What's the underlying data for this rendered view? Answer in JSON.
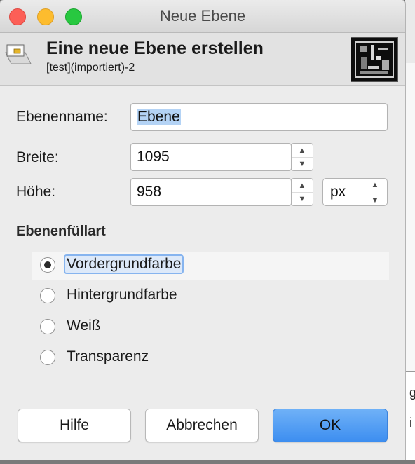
{
  "window": {
    "title": "Neue Ebene"
  },
  "header": {
    "title": "Eine neue Ebene erstellen",
    "subtitle": "[test](importiert)-2"
  },
  "form": {
    "name_label": "Ebenenname:",
    "name_value": "Ebene",
    "width_label": "Breite:",
    "width_value": "1095",
    "height_label": "Höhe:",
    "height_value": "958",
    "unit_value": "px"
  },
  "fill": {
    "title": "Ebenenfüllart",
    "options": [
      {
        "label": "Vordergrundfarbe",
        "selected": true
      },
      {
        "label": "Hintergrundfarbe",
        "selected": false
      },
      {
        "label": "Weiß",
        "selected": false
      },
      {
        "label": "Transparenz",
        "selected": false
      }
    ]
  },
  "buttons": {
    "help": "Hilfe",
    "cancel": "Abbrechen",
    "ok": "OK"
  },
  "background": {
    "fragment_1": "g",
    "fragment_2": "i"
  },
  "colors": {
    "accent": "#3d8ef0",
    "selection": "#b4d3f5",
    "close": "#fc5f57",
    "minimize": "#fdbc2e",
    "maximize": "#28c840"
  },
  "icons": {
    "layer": "new-layer-icon",
    "spin_up": "triangle-up",
    "spin_down": "triangle-down"
  }
}
